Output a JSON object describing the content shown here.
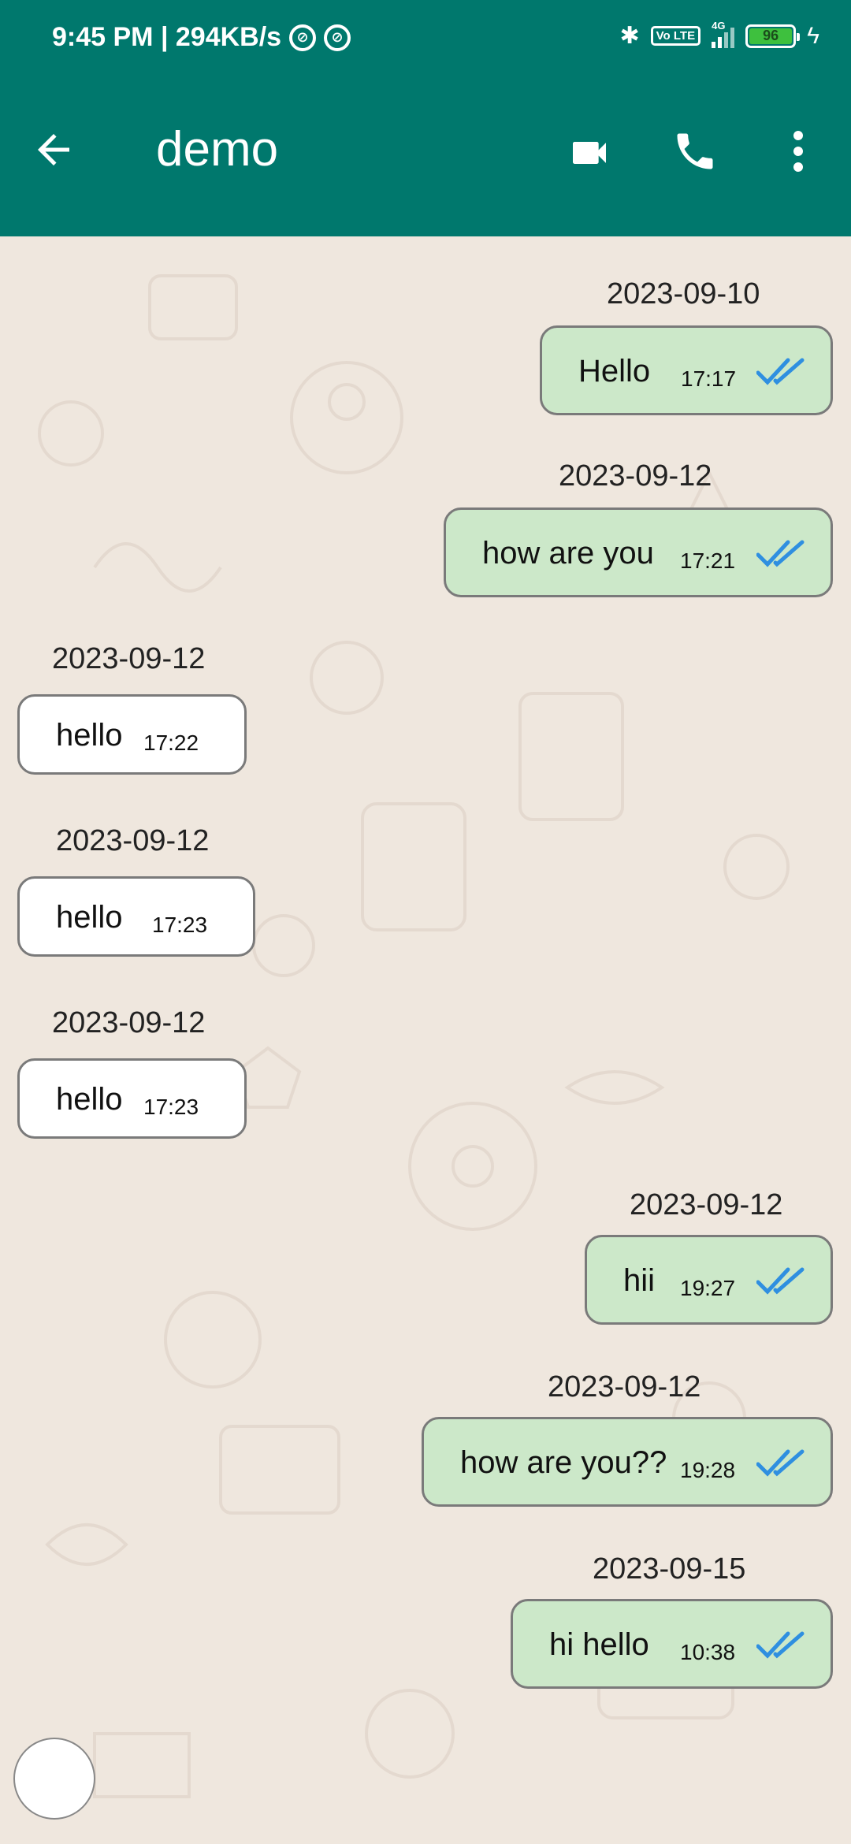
{
  "status_bar": {
    "time": "9:45 PM | 294KB/s",
    "volte": "Vo LTE",
    "network": "4G",
    "battery": "96"
  },
  "header": {
    "title": "demo"
  },
  "messages": [
    {
      "date": "2023-09-10",
      "text": "Hello",
      "time": "17:17",
      "direction": "out"
    },
    {
      "date": "2023-09-12",
      "text": "how are you",
      "time": "17:21",
      "direction": "out"
    },
    {
      "date": "2023-09-12",
      "text": "hello",
      "time": "17:22",
      "direction": "in"
    },
    {
      "date": "2023-09-12",
      "text": "hello",
      "time": "17:23",
      "direction": "in"
    },
    {
      "date": "2023-09-12",
      "text": "hello",
      "time": "17:23",
      "direction": "in"
    },
    {
      "date": "2023-09-12",
      "text": "hii",
      "time": "19:27",
      "direction": "out"
    },
    {
      "date": "2023-09-12",
      "text": "how are you??",
      "time": "19:28",
      "direction": "out"
    },
    {
      "date": "2023-09-15",
      "text": "hi hello",
      "time": "10:38",
      "direction": "out"
    }
  ],
  "colors": {
    "primary": "#00786d",
    "outgoing_bubble": "#cce8c9",
    "incoming_bubble": "#ffffff",
    "read_ticks": "#2f8fe0",
    "chat_background": "#efe7de"
  },
  "icons": {
    "back": "arrow-left-icon",
    "video": "video-camera-icon",
    "call": "phone-icon",
    "more": "more-vertical-icon",
    "read": "double-check-icon"
  }
}
